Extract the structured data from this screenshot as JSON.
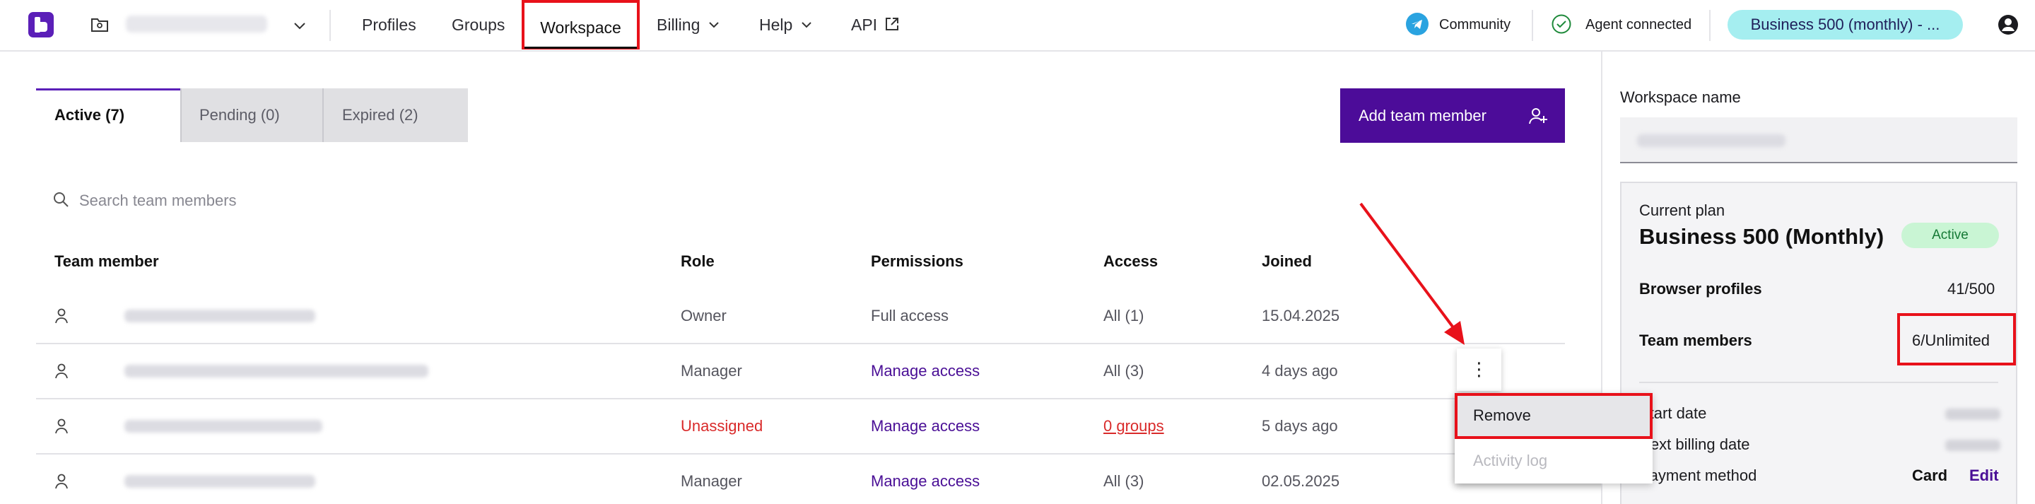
{
  "nav": {
    "items": [
      "Profiles",
      "Groups",
      "Workspace",
      "Billing",
      "Help",
      "API"
    ],
    "community": "Community",
    "agent_status": "Agent connected",
    "plan_pill": "Business 500 (monthly) - ..."
  },
  "tabs": {
    "active": "Active (7)",
    "pending": "Pending (0)",
    "expired": "Expired (2)"
  },
  "add_button": "Add team member",
  "search": {
    "placeholder": "Search team members"
  },
  "table": {
    "headers": [
      "Team member",
      "Role",
      "Permissions",
      "Access",
      "Joined"
    ],
    "rows": [
      {
        "role": "Owner",
        "permissions": "Full access",
        "access": "All (1)",
        "joined": "15.04.2025"
      },
      {
        "role": "Manager",
        "permissions": "Manage access",
        "access": "All (3)",
        "joined": "4 days ago"
      },
      {
        "role": "Unassigned",
        "permissions": "Manage access",
        "access": "0 groups",
        "joined": "5 days ago"
      },
      {
        "role": "Manager",
        "permissions": "Manage access",
        "access": "All (3)",
        "joined": "02.05.2025"
      }
    ]
  },
  "context_menu": {
    "kebab": "⋮",
    "remove": "Remove",
    "activity_log": "Activity log"
  },
  "panel": {
    "workspace_name_label": "Workspace name",
    "current_plan_label": "Current plan",
    "plan_name": "Business 500 (Monthly)",
    "status_badge": "Active",
    "browser_profiles_label": "Browser profiles",
    "browser_profiles_value": "41/500",
    "team_members_label": "Team members",
    "team_members_value": "6/Unlimited",
    "start_date_label": "Start date",
    "next_billing_label": "Next billing date",
    "payment_method_label": "Payment method",
    "payment_method_value": "Card",
    "edit_label": "Edit"
  },
  "colors": {
    "brand": "#5b1fb8",
    "primary_button": "#4c0c99",
    "highlight": "#e8111a",
    "plan_pill": "#a5eef0",
    "active_badge": "#c9f5d4"
  }
}
